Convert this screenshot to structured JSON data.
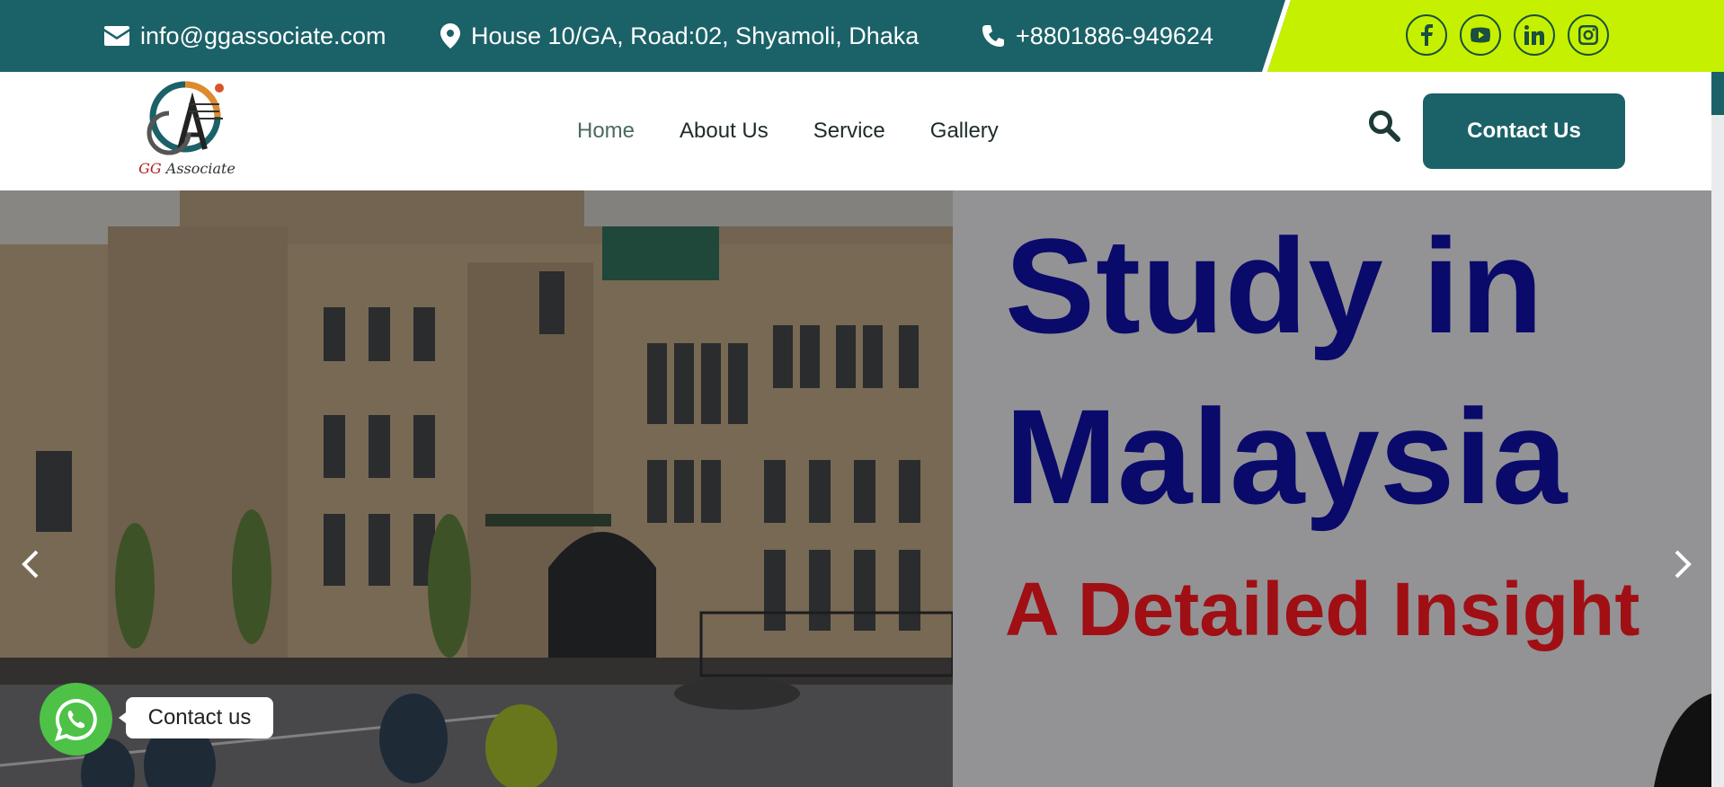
{
  "topbar": {
    "email": "info@ggassociate.com",
    "address": "House 10/GA, Road:02, Shyamoli, Dhaka",
    "phone": "+8801886-949624",
    "socials": [
      "facebook-icon",
      "youtube-icon",
      "linkedin-icon",
      "instagram-icon"
    ],
    "bg_color": "#1b6168",
    "accent_color": "#c5f100"
  },
  "header": {
    "logo_text_gg": "GG",
    "logo_text_rest": " Associate",
    "nav": [
      "Home",
      "About Us",
      "Service",
      "Gallery"
    ],
    "active_nav": "Home",
    "cta_label": "Contact Us"
  },
  "hero": {
    "line1": "Study in",
    "line2": "Malaysia",
    "line3": "A Detailed Insight",
    "title_color": "#0a0a6b",
    "subtitle_color": "#a00f14"
  },
  "whatsapp": {
    "label": "Contact us",
    "color": "#4dc247"
  }
}
